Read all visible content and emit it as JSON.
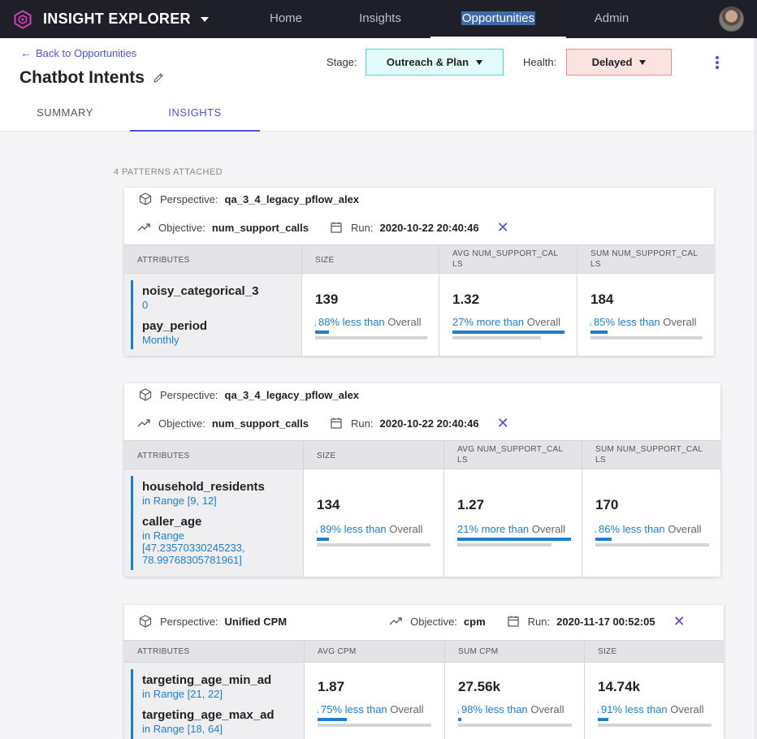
{
  "nav": {
    "brand": "INSIGHT EXPLORER",
    "links": [
      "Home",
      "Insights",
      "Opportunities",
      "Admin"
    ],
    "active": "Opportunities"
  },
  "header": {
    "back_label": "Back to Opportunities",
    "title": "Chatbot Intents",
    "stage_label": "Stage:",
    "stage_value": "Outreach & Plan",
    "health_label": "Health:",
    "health_value": "Delayed",
    "tabs": [
      "SUMMARY",
      "INSIGHTS"
    ],
    "active_tab": "INSIGHTS"
  },
  "patterns_count_label": "4 PATTERNS ATTACHED",
  "cards": [
    {
      "perspective_label": "Perspective:",
      "perspective": "qa_3_4_legacy_pflow_alex",
      "objective_label": "Objective:",
      "objective": "num_support_calls",
      "run_label": "Run:",
      "run": "2020-10-22 20:40:46",
      "columns": [
        "ATTRIBUTES",
        "SIZE",
        "AVG NUM_SUPPORT_CAL LS",
        "SUM NUM_SUPPORT_CAL LS"
      ],
      "attributes": [
        {
          "name": "noisy_categorical_3",
          "value": "0"
        },
        {
          "name": "pay_period",
          "value": "Monthly"
        }
      ],
      "metrics": [
        {
          "value": "139",
          "dir_text": "88% less than",
          "suffix": "Overall",
          "arrow": "↓",
          "fill": 0.12
        },
        {
          "value": "1.32",
          "dir_text": "27% more than",
          "suffix": "Overall",
          "arrow": "",
          "fill": 1.0
        },
        {
          "value": "184",
          "dir_text": "85% less than",
          "suffix": "Overall",
          "arrow": "↓",
          "fill": 0.15
        }
      ],
      "secondary_fill": [
        1.0,
        0.79,
        1.0
      ]
    },
    {
      "perspective_label": "Perspective:",
      "perspective": "qa_3_4_legacy_pflow_alex",
      "objective_label": "Objective:",
      "objective": "num_support_calls",
      "run_label": "Run:",
      "run": "2020-10-22 20:40:46",
      "columns": [
        "ATTRIBUTES",
        "SIZE",
        "AVG NUM_SUPPORT_CAL LS",
        "SUM NUM_SUPPORT_CAL LS"
      ],
      "attributes": [
        {
          "name": "household_residents",
          "value": "in Range [9, 12]"
        },
        {
          "name": "caller_age",
          "value": "in Range [47.23570330245233, 78.99768305781961]"
        }
      ],
      "metrics": [
        {
          "value": "134",
          "dir_text": "89% less than",
          "suffix": "Overall",
          "arrow": "↓",
          "fill": 0.11
        },
        {
          "value": "1.27",
          "dir_text": "21% more than",
          "suffix": "Overall",
          "arrow": "",
          "fill": 1.0
        },
        {
          "value": "170",
          "dir_text": "86% less than",
          "suffix": "Overall",
          "arrow": "↓",
          "fill": 0.14
        }
      ],
      "secondary_fill": [
        1.0,
        0.83,
        1.0
      ]
    },
    {
      "perspective_label": "Perspective:",
      "perspective": "Unified CPM",
      "objective_label": "Objective:",
      "objective": "cpm",
      "run_label": "Run:",
      "run": "2020-11-17 00:52:05",
      "columns": [
        "ATTRIBUTES",
        "AVG CPM",
        "SUM CPM",
        "SIZE"
      ],
      "attributes": [
        {
          "name": "targeting_age_min_ad",
          "value": "in Range [21, 22]"
        },
        {
          "name": "targeting_age_max_ad",
          "value": "in Range [18, 64]"
        }
      ],
      "metrics": [
        {
          "value": "1.87",
          "dir_text": "75% less than",
          "suffix": "Overall",
          "arrow": "↓",
          "fill": 0.26
        },
        {
          "value": "27.56k",
          "dir_text": "98% less than",
          "suffix": "Overall",
          "arrow": "↓",
          "fill": 0.03
        },
        {
          "value": "14.74k",
          "dir_text": "91% less than",
          "suffix": "Overall",
          "arrow": "↓",
          "fill": 0.09
        }
      ],
      "secondary_fill": [
        1.0,
        1.0,
        1.0
      ]
    }
  ],
  "colors": {
    "nav_bg": "#1f1f2a",
    "accent": "#4c55d6",
    "attr_blue": "#1e7fd1",
    "stage_bg": "#e3fbfb",
    "health_bg": "#fde2e2"
  }
}
